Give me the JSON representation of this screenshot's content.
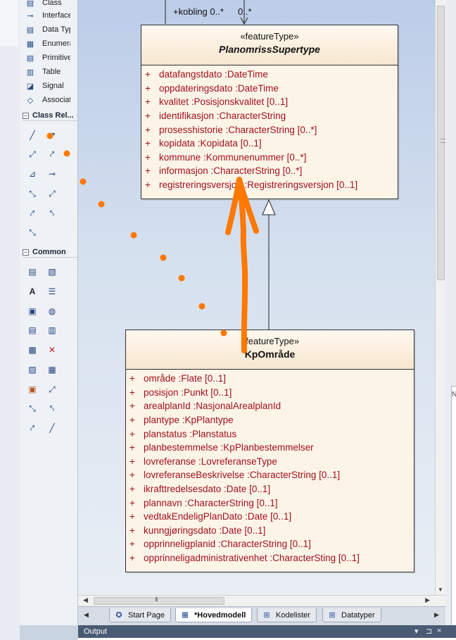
{
  "toolbox": {
    "items_top": [
      {
        "label": "Class",
        "icon": "class-icon"
      },
      {
        "label": "Interface",
        "icon": "interface-icon"
      },
      {
        "label": "Data Type",
        "icon": "datatype-icon"
      },
      {
        "label": "Enumeration",
        "icon": "enumeration-icon"
      },
      {
        "label": "Primitive",
        "icon": "primitive-icon"
      },
      {
        "label": "Table",
        "icon": "table-icon"
      },
      {
        "label": "Signal",
        "icon": "signal-icon"
      },
      {
        "label": "Association",
        "icon": "association-icon"
      }
    ],
    "section_relationships": "Class Rel...",
    "section_common": "Common",
    "section_toggle": "−"
  },
  "diagram": {
    "association_label": "+kobling 0..*",
    "association_mult": "0..*",
    "supertype": {
      "stereotype": "«featureType»",
      "name": "PlanomrissSupertype",
      "attributes": [
        "datafangstdato  :DateTime",
        "oppdateringsdato  :DateTime",
        "kvalitet  :Posisjonskvalitet [0..1]",
        "identifikasjon  :CharacterString",
        "prosesshistorie  :CharacterString [0..*]",
        "kopidata  :Kopidata [0..1]",
        "kommune  :Kommunenummer [0..*]",
        "informasjon  :CharacterString [0..*]",
        "registreringsversjon  :Registreringsversjon [0..1]"
      ]
    },
    "subtype": {
      "stereotype": "«featureType»",
      "name": "KpOmråde",
      "attributes": [
        "område  :Flate [0..1]",
        "posisjon  :Punkt [0..1]",
        "arealplanId  :NasjonalArealplanId",
        "plantype  :KpPlantype",
        "planstatus  :Planstatus",
        "planbestemmelse  :KpPlanbestemmelser",
        "lovreferanse  :LovreferanseType",
        "lovreferanseBeskrivelse  :CharacterString [0..1]",
        "ikrafttredelsesdato  :Date [0..1]",
        "plannavn  :CharacterString [0..1]",
        "vedtakEndeligPlanDato  :Date [0..1]",
        "kunngjøringsdato  :Date [0..1]",
        "opprinneligplanid  :CharacterString [0..1]",
        "opprinneligadministrativenhet  :CharacterSting [0..1]"
      ]
    },
    "plus": "+"
  },
  "tabs": [
    {
      "label": "Start Page",
      "icon": "start-page-icon",
      "active": false
    },
    {
      "label": "*Hovedmodell",
      "icon": "diagram-icon",
      "active": true
    },
    {
      "label": "Kodelister",
      "icon": "diagram-icon",
      "active": false
    },
    {
      "label": "Datatyper",
      "icon": "diagram-icon",
      "active": false
    }
  ],
  "output": {
    "title": "Output",
    "pin": "⊐",
    "close": "×",
    "dropdown": "▾"
  },
  "scroll": {
    "grip": "III"
  },
  "right_panel": {
    "edge_label": "N"
  },
  "colors": {
    "annotation_orange": "#ff7800",
    "attribute_red": "#a0101e",
    "class_fill": "#fdf4e8"
  }
}
